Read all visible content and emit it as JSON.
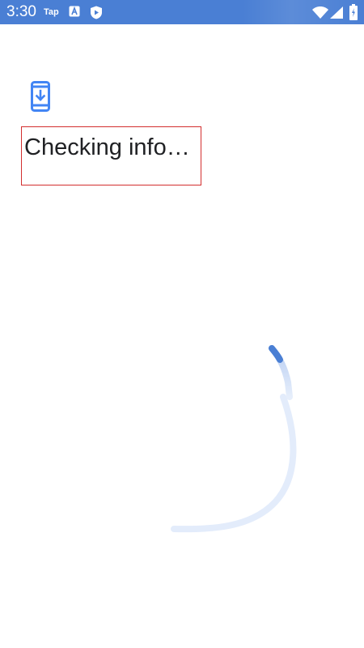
{
  "status_bar": {
    "time": "3:30",
    "app_label": "Tap",
    "icons": [
      "accessibility-a-icon",
      "play-shield-icon",
      "wifi-icon",
      "signal-icon",
      "battery-icon"
    ]
  },
  "main": {
    "app_icon": "phone-download-icon",
    "status_text": "Checking info…",
    "loading_indicator": "circular-progress-spinner"
  },
  "colors": {
    "status_bar": "#4a7fd4",
    "accent": "#4285f4",
    "highlight_border": "#d32f2f",
    "text": "#202124"
  }
}
